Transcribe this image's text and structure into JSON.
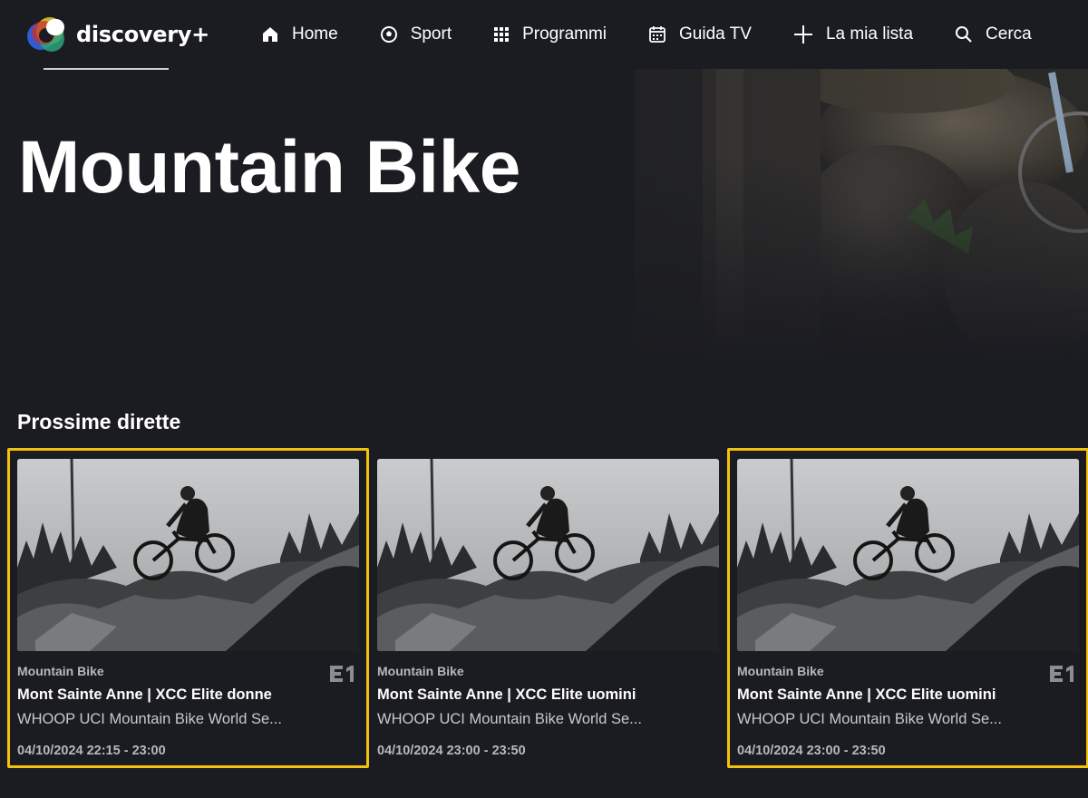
{
  "brand": {
    "name": "discovery+",
    "colors": {
      "accent_highlight": "#f4c20d",
      "background": "#1b1c21"
    }
  },
  "nav": {
    "items": [
      {
        "label": "Home",
        "icon": "home-icon"
      },
      {
        "label": "Sport",
        "icon": "soccer-ball-icon"
      },
      {
        "label": "Programmi",
        "icon": "grid-icon"
      },
      {
        "label": "Guida TV",
        "icon": "calendar-icon"
      },
      {
        "label": "La mia lista",
        "icon": "plus-icon"
      },
      {
        "label": "Cerca",
        "icon": "search-icon"
      }
    ]
  },
  "hero": {
    "title": "Mountain Bike"
  },
  "section": {
    "title": "Prossime dirette"
  },
  "cards": [
    {
      "category": "Mountain Bike",
      "title": "Mont Sainte Anne | XCC Elite donne",
      "subtitle": "WHOOP UCI Mountain Bike World Se...",
      "time": "04/10/2024 22:15 - 23:00",
      "channel_icon": "eurosport1-icon",
      "highlighted": true
    },
    {
      "category": "Mountain Bike",
      "title": "Mont Sainte Anne | XCC Elite uomini",
      "subtitle": "WHOOP UCI Mountain Bike World Se...",
      "time": "04/10/2024 23:00 - 23:50",
      "channel_icon": "",
      "highlighted": false
    },
    {
      "category": "Mountain Bike",
      "title": "Mont Sainte Anne | XCC Elite uomini",
      "subtitle": "WHOOP UCI Mountain Bike World Se...",
      "time": "04/10/2024 23:00 - 23:50",
      "channel_icon": "eurosport1-icon",
      "highlighted": true
    }
  ]
}
